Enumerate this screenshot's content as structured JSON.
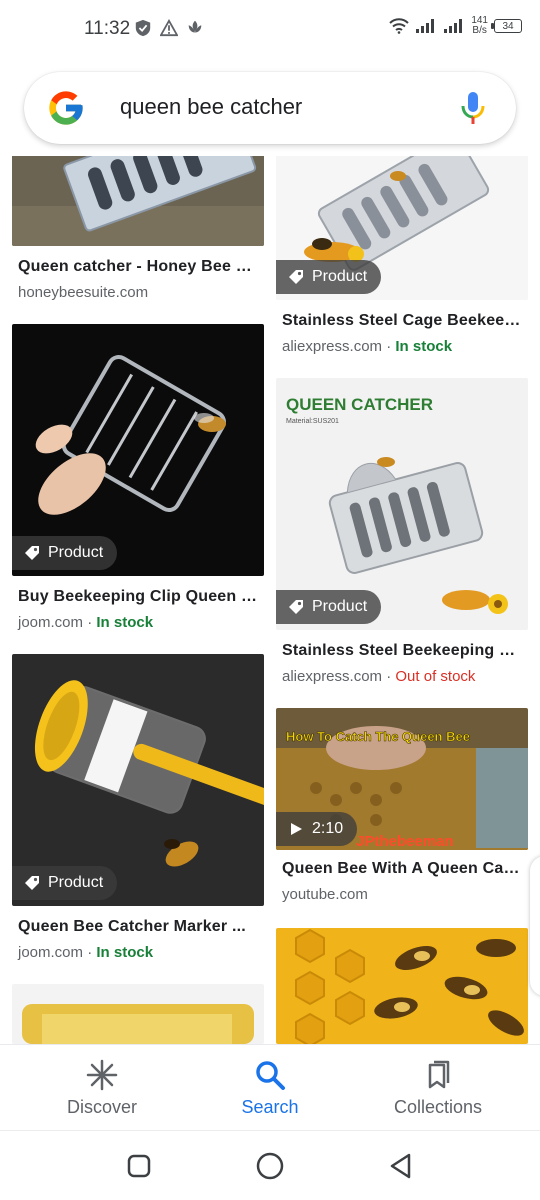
{
  "status_bar": {
    "time": "11:32",
    "speed_value": "141",
    "speed_unit": "B/s",
    "battery": "34"
  },
  "search": {
    "query": "queen bee catcher"
  },
  "results": [
    {
      "title": "Queen catcher - Honey Bee S...",
      "source": "honeybeesuite.com",
      "badge": "",
      "stock": ""
    },
    {
      "title": "Stainless Steel Cage Beekeep...",
      "source": "aliexpress.com",
      "badge": "Product",
      "stock": "In stock",
      "stock_status": "in"
    },
    {
      "title": "Buy Beekeeping Clip Queen B...",
      "source": "joom.com",
      "badge": "Product",
      "stock": "In stock",
      "stock_status": "in"
    },
    {
      "title": "Stainless Steel Beekeeping Q...",
      "source": "aliexpress.com",
      "badge": "Product",
      "stock": "Out of stock",
      "stock_status": "out",
      "image_text": "QUEEN CATCHER",
      "image_subtext": "Material:SUS201"
    },
    {
      "title": "Queen Bee Catcher Marker ...",
      "source": "joom.com",
      "badge": "Product",
      "stock": "In stock",
      "stock_status": "in"
    },
    {
      "title": "Queen Bee With A Queen Cat...",
      "source": "youtube.com",
      "badge": "2:10",
      "stock": "",
      "image_text": "How To Catch The Queen Bee",
      "image_subtext": "JPthebeeman"
    }
  ],
  "bottom_nav": {
    "items": [
      {
        "label": "Discover",
        "icon": "asterisk-icon"
      },
      {
        "label": "Search",
        "icon": "search-icon",
        "active": true
      },
      {
        "label": "Collections",
        "icon": "collections-icon"
      }
    ]
  },
  "colors": {
    "accent": "#1a73e8",
    "in_stock": "#188038",
    "out_of_stock": "#d93025"
  }
}
